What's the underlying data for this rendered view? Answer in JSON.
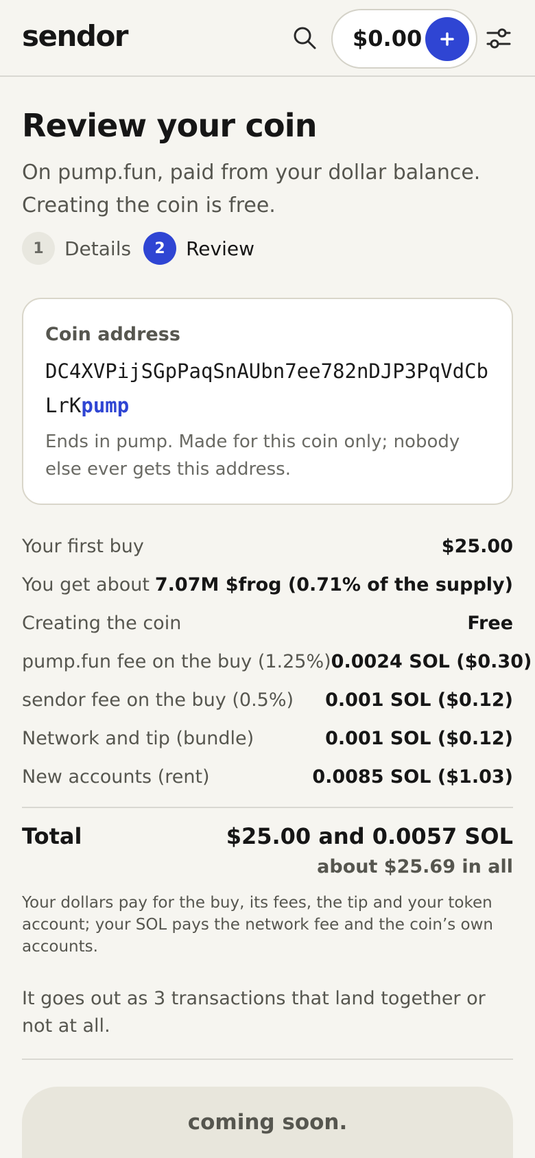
{
  "header": {
    "logo": "sendor",
    "balance": "$0.00",
    "icons": {
      "search": "search-icon",
      "add": "plus-icon",
      "settings": "sliders-icon"
    }
  },
  "page": {
    "title": "Review your coin",
    "subtitle": "On pump.fun, paid from your dollar balance. Creating the coin is free."
  },
  "steps": [
    {
      "number": "1",
      "label": "Details",
      "active": false
    },
    {
      "number": "2",
      "label": "Review",
      "active": true
    }
  ],
  "address_card": {
    "label": "Coin address",
    "address_prefix": "DC4XVPijSGpPaqSnAUbn7ee782nDJP3PqVdCbLrK",
    "address_suffix": "pump",
    "note": "Ends in pump. Made for this coin only; nobody else ever gets this address."
  },
  "fees": [
    {
      "label": "Your first buy",
      "value": "$25.00"
    },
    {
      "label": "You get about",
      "value": "7.07M $frog (0.71% of the supply)"
    },
    {
      "label": "Creating the coin",
      "value": "Free"
    },
    {
      "label": "pump.fun fee on the buy (1.25%)",
      "value": "0.0024 SOL ($0.30)"
    },
    {
      "label": "sendor fee on the buy (0.5%)",
      "value": "0.001 SOL ($0.12)"
    },
    {
      "label": "Network and tip (bundle)",
      "value": "0.001 SOL ($0.12)"
    },
    {
      "label": "New accounts (rent)",
      "value": "0.0085 SOL ($1.03)"
    }
  ],
  "total": {
    "label": "Total",
    "value": "$25.00 and 0.0057 SOL",
    "approx": "about $25.69 in all"
  },
  "notes": {
    "payment": "Your dollars pay for the buy, its fees, the tip and your token account; your SOL pays the network fee and the coin’s own accounts.",
    "transactions": "It goes out as 3 transactions that land together or not at all."
  },
  "cta": {
    "label": "coming soon."
  },
  "colors": {
    "accent": "#2f45d3",
    "background": "#f6f5f0",
    "card": "#ffffff",
    "muted_text": "#56564f"
  }
}
